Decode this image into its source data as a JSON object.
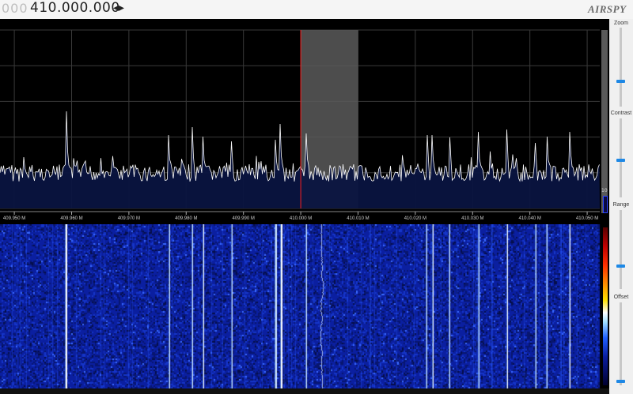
{
  "header": {
    "freq_prefix": "000",
    "freq_main": "410.000.000",
    "step_arrows": "◂▸",
    "logo": "AIRSPY"
  },
  "sidebar": {
    "zoom_label": "Zoom",
    "contrast_label": "Contrast",
    "range_label": "Range",
    "offset_label": "Offset",
    "level_marker": "10"
  },
  "spectrum": {
    "x_min_mhz": 409.9475,
    "x_max_mhz": 410.0522,
    "tick_labels": [
      "409.950 M",
      "409.960 M",
      "409.970 M",
      "409.980 M",
      "409.990 M",
      "410.000 M",
      "410.010 M",
      "410.020 M",
      "410.030 M",
      "410.040 M",
      "410.050 M"
    ],
    "tick_values_mhz": [
      409.95,
      409.96,
      409.97,
      409.98,
      409.99,
      410.0,
      410.01,
      410.02,
      410.03,
      410.04,
      410.05
    ],
    "center_frequency_mhz": 410.0,
    "filter_band_mhz": [
      410.0,
      410.01
    ],
    "peaks_mhz": [
      409.959,
      409.977,
      409.981,
      409.983,
      409.988,
      409.9955,
      409.9965,
      410.001,
      410.022,
      410.023,
      410.026,
      410.031,
      410.036,
      410.041,
      410.043,
      410.047
    ]
  },
  "colors": {
    "accent": "#1e88e5",
    "spectrum_trace": "#ffffff",
    "spectrum_fill": "#0a1440",
    "filter_band": "#5a5a5a",
    "center_line": "#ff2020",
    "waterfall_base": "#0b1fa0"
  }
}
